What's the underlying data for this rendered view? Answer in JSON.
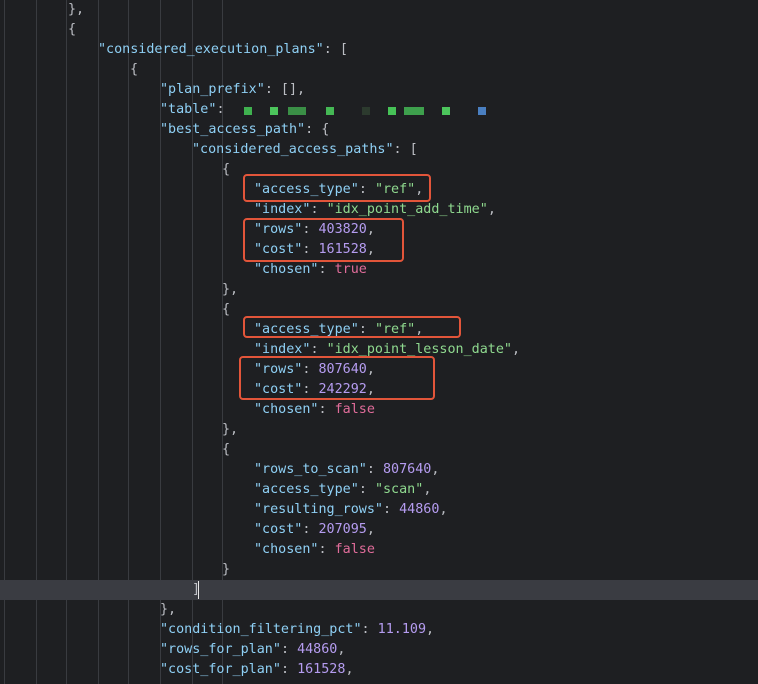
{
  "editor": {
    "lines": [
      {
        "indent": 68,
        "tokens": [
          {
            "t": "},",
            "c": "p"
          }
        ]
      },
      {
        "indent": 68,
        "tokens": [
          {
            "t": "{",
            "c": "p"
          }
        ]
      },
      {
        "indent": 98,
        "tokens": [
          {
            "t": "\"considered_execution_plans\"",
            "c": "k"
          },
          {
            "t": ": [",
            "c": "p"
          }
        ]
      },
      {
        "indent": 130,
        "tokens": [
          {
            "t": "{",
            "c": "p"
          }
        ]
      },
      {
        "indent": 160,
        "tokens": [
          {
            "t": "\"plan_prefix\"",
            "c": "k"
          },
          {
            "t": ": [],",
            "c": "p"
          }
        ]
      },
      {
        "indent": 160,
        "tokens": [
          {
            "t": "\"table\"",
            "c": "k"
          },
          {
            "t": ":",
            "c": "p"
          }
        ],
        "redacted": true
      },
      {
        "indent": 160,
        "tokens": [
          {
            "t": "\"best_access_path\"",
            "c": "k"
          },
          {
            "t": ": {",
            "c": "p"
          }
        ]
      },
      {
        "indent": 192,
        "tokens": [
          {
            "t": "\"considered_access_paths\"",
            "c": "k"
          },
          {
            "t": ": [",
            "c": "p"
          }
        ]
      },
      {
        "indent": 222,
        "tokens": [
          {
            "t": "{",
            "c": "p"
          }
        ]
      },
      {
        "indent": 254,
        "tokens": [
          {
            "t": "\"access_type\"",
            "c": "k"
          },
          {
            "t": ": ",
            "c": "p"
          },
          {
            "t": "\"ref\"",
            "c": "s"
          },
          {
            "t": ",",
            "c": "p"
          }
        ]
      },
      {
        "indent": 254,
        "tokens": [
          {
            "t": "\"index\"",
            "c": "k"
          },
          {
            "t": ": ",
            "c": "p"
          },
          {
            "t": "\"idx_point_add_time\"",
            "c": "s"
          },
          {
            "t": ",",
            "c": "p"
          }
        ]
      },
      {
        "indent": 254,
        "tokens": [
          {
            "t": "\"rows\"",
            "c": "k"
          },
          {
            "t": ": ",
            "c": "p"
          },
          {
            "t": "403820",
            "c": "n"
          },
          {
            "t": ",",
            "c": "p"
          }
        ]
      },
      {
        "indent": 254,
        "tokens": [
          {
            "t": "\"cost\"",
            "c": "k"
          },
          {
            "t": ": ",
            "c": "p"
          },
          {
            "t": "161528",
            "c": "n"
          },
          {
            "t": ",",
            "c": "p"
          }
        ]
      },
      {
        "indent": 254,
        "tokens": [
          {
            "t": "\"chosen\"",
            "c": "k"
          },
          {
            "t": ": ",
            "c": "p"
          },
          {
            "t": "true",
            "c": "kw"
          }
        ]
      },
      {
        "indent": 222,
        "tokens": [
          {
            "t": "},",
            "c": "p"
          }
        ]
      },
      {
        "indent": 222,
        "tokens": [
          {
            "t": "{",
            "c": "p"
          }
        ]
      },
      {
        "indent": 254,
        "tokens": [
          {
            "t": "\"access_type\"",
            "c": "k"
          },
          {
            "t": ": ",
            "c": "p"
          },
          {
            "t": "\"ref\"",
            "c": "s"
          },
          {
            "t": ",",
            "c": "p"
          }
        ]
      },
      {
        "indent": 254,
        "tokens": [
          {
            "t": "\"index\"",
            "c": "k"
          },
          {
            "t": ": ",
            "c": "p"
          },
          {
            "t": "\"idx_point_lesson_date\"",
            "c": "s"
          },
          {
            "t": ",",
            "c": "p"
          }
        ]
      },
      {
        "indent": 254,
        "tokens": [
          {
            "t": "\"rows\"",
            "c": "k"
          },
          {
            "t": ": ",
            "c": "p"
          },
          {
            "t": "807640",
            "c": "n"
          },
          {
            "t": ",",
            "c": "p"
          }
        ]
      },
      {
        "indent": 254,
        "tokens": [
          {
            "t": "\"cost\"",
            "c": "k"
          },
          {
            "t": ": ",
            "c": "p"
          },
          {
            "t": "242292",
            "c": "n"
          },
          {
            "t": ",",
            "c": "p"
          }
        ]
      },
      {
        "indent": 254,
        "tokens": [
          {
            "t": "\"chosen\"",
            "c": "k"
          },
          {
            "t": ": ",
            "c": "p"
          },
          {
            "t": "false",
            "c": "kw"
          }
        ]
      },
      {
        "indent": 222,
        "tokens": [
          {
            "t": "},",
            "c": "p"
          }
        ]
      },
      {
        "indent": 222,
        "tokens": [
          {
            "t": "{",
            "c": "p"
          }
        ]
      },
      {
        "indent": 254,
        "tokens": [
          {
            "t": "\"rows_to_scan\"",
            "c": "k"
          },
          {
            "t": ": ",
            "c": "p"
          },
          {
            "t": "807640",
            "c": "n"
          },
          {
            "t": ",",
            "c": "p"
          }
        ]
      },
      {
        "indent": 254,
        "tokens": [
          {
            "t": "\"access_type\"",
            "c": "k"
          },
          {
            "t": ": ",
            "c": "p"
          },
          {
            "t": "\"scan\"",
            "c": "s"
          },
          {
            "t": ",",
            "c": "p"
          }
        ]
      },
      {
        "indent": 254,
        "tokens": [
          {
            "t": "\"resulting_rows\"",
            "c": "k"
          },
          {
            "t": ": ",
            "c": "p"
          },
          {
            "t": "44860",
            "c": "n"
          },
          {
            "t": ",",
            "c": "p"
          }
        ]
      },
      {
        "indent": 254,
        "tokens": [
          {
            "t": "\"cost\"",
            "c": "k"
          },
          {
            "t": ": ",
            "c": "p"
          },
          {
            "t": "207095",
            "c": "n"
          },
          {
            "t": ",",
            "c": "p"
          }
        ]
      },
      {
        "indent": 254,
        "tokens": [
          {
            "t": "\"chosen\"",
            "c": "k"
          },
          {
            "t": ": ",
            "c": "p"
          },
          {
            "t": "false",
            "c": "kw"
          }
        ]
      },
      {
        "indent": 222,
        "tokens": [
          {
            "t": "}",
            "c": "p"
          }
        ]
      },
      {
        "indent": 192,
        "tokens": [
          {
            "t": "]",
            "c": "p"
          }
        ],
        "current": true
      },
      {
        "indent": 160,
        "tokens": [
          {
            "t": "},",
            "c": "p"
          }
        ]
      },
      {
        "indent": 160,
        "tokens": [
          {
            "t": "\"condition_filtering_pct\"",
            "c": "k"
          },
          {
            "t": ": ",
            "c": "p"
          },
          {
            "t": "11.109",
            "c": "n"
          },
          {
            "t": ",",
            "c": "p"
          }
        ]
      },
      {
        "indent": 160,
        "tokens": [
          {
            "t": "\"rows_for_plan\"",
            "c": "k"
          },
          {
            "t": ": ",
            "c": "p"
          },
          {
            "t": "44860",
            "c": "n"
          },
          {
            "t": ",",
            "c": "p"
          }
        ]
      },
      {
        "indent": 160,
        "tokens": [
          {
            "t": "\"cost_for_plan\"",
            "c": "k"
          },
          {
            "t": ": ",
            "c": "p"
          },
          {
            "t": "161528",
            "c": "n"
          },
          {
            "t": ",",
            "c": "p"
          }
        ]
      }
    ]
  },
  "highlight_color": "#e2553a",
  "colors": {
    "background": "#1e1f22",
    "key": "#8fd0f5",
    "string": "#8fd98f",
    "number": "#b59cf0",
    "keyword": "#e06c9a"
  }
}
